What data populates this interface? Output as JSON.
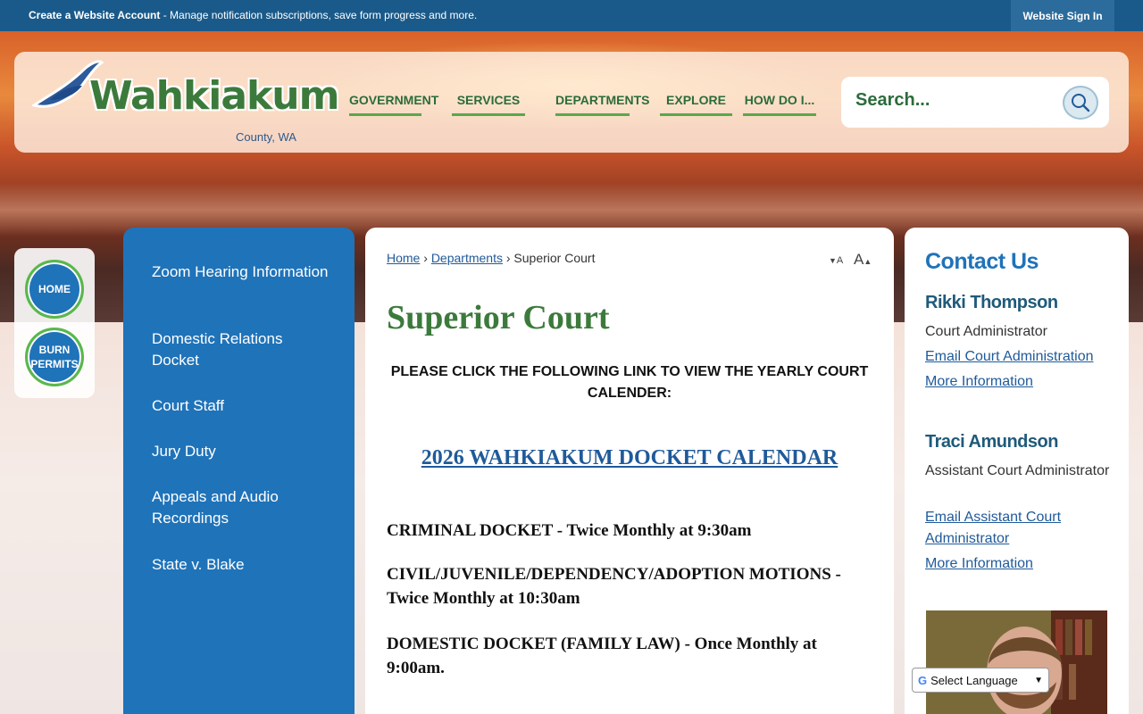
{
  "topbar": {
    "create_account_bold": "Create a Website Account",
    "create_account_rest": " - Manage notification subscriptions, save form progress and more.",
    "signin": "Website Sign In"
  },
  "logo": {
    "name": "Wahkiakum",
    "sub": "County, WA"
  },
  "nav": [
    {
      "label": "GOVERNMENT"
    },
    {
      "label": "SERVICES"
    },
    {
      "label": "DEPARTMENTS"
    },
    {
      "label": "EXPLORE"
    },
    {
      "label": "HOW DO I..."
    }
  ],
  "search": {
    "placeholder": "Search..."
  },
  "quick_links": [
    {
      "label": "HOME"
    },
    {
      "label": "BURN PERMITS"
    }
  ],
  "sidebar": {
    "items": [
      {
        "label": "Zoom Hearing Information"
      },
      {
        "label": "Domestic Relations Docket"
      },
      {
        "label": "Court Staff"
      },
      {
        "label": "Jury Duty"
      },
      {
        "label": "Appeals and Audio Recordings"
      },
      {
        "label": "State v. Blake"
      }
    ]
  },
  "breadcrumb": {
    "home": "Home",
    "departments": "Departments",
    "current": "Superior Court"
  },
  "font_controls": {
    "decrease": "A",
    "increase": "A"
  },
  "main": {
    "title": "Superior Court",
    "notice": "PLEASE CLICK THE FOLLOWING LINK TO VIEW THE YEARLY COURT CALENDER:",
    "docket_link": "2026 WAHKIAKUM DOCKET CALENDAR",
    "paragraphs": [
      "CRIMINAL DOCKET  - Twice Monthly at 9:30am",
      "CIVIL/JUVENILE/DEPENDENCY/ADOPTION MOTIONS - Twice Monthly at 10:30am",
      "DOMESTIC DOCKET (FAMILY LAW) - Once Monthly at 9:00am."
    ]
  },
  "contact": {
    "title": "Contact Us",
    "people": [
      {
        "name": "Rikki Thompson",
        "role": "Court Administrator",
        "email": "Email Court Administration",
        "more": "More Information"
      },
      {
        "name": "Traci Amundson",
        "role": "Assistant Court Administrator",
        "email": "Email Assistant Court Administrator",
        "more": "More Information"
      }
    ]
  },
  "language": {
    "label": "Select Language"
  },
  "colors": {
    "brand_blue": "#1f73b9",
    "brand_green": "#3c7a3c",
    "topbar": "#1a5a8a"
  }
}
